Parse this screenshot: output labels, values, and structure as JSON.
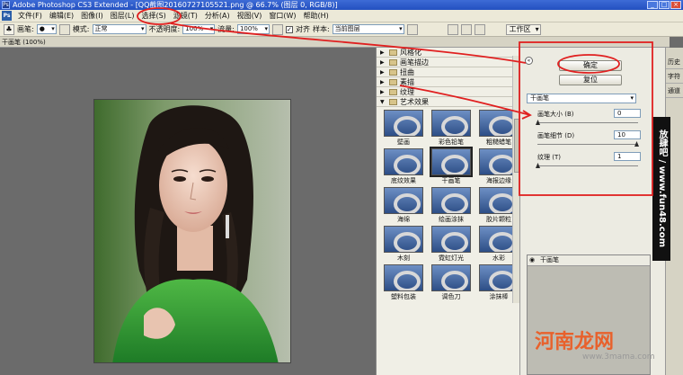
{
  "window": {
    "title": "Adobe Photoshop CS3 Extended - [QQ截图20160727105521.png @ 66.7% (图层 0, RGB/8)]",
    "controls": [
      "_",
      "□",
      "×"
    ]
  },
  "menubar": {
    "items": [
      "文件(F)",
      "编辑(E)",
      "图像(I)",
      "图层(L)",
      "选择(S)",
      "滤镜(T)",
      "分析(A)",
      "视图(V)",
      "窗口(W)",
      "帮助(H)"
    ]
  },
  "options_bar": {
    "tool_label": "画笔:",
    "mode_label": "模式:",
    "mode_value": "正常",
    "opacity_label": "不透明度:",
    "opacity_value": "100%",
    "flow_label": "流量:",
    "flow_value": "100%",
    "align_label": "对齐",
    "sample_label": "样本:",
    "sample_value": "当前图层",
    "workspace_label": "工作区"
  },
  "document": {
    "tab_label": "干画笔 (100%)"
  },
  "gallery": {
    "categories": [
      "风格化",
      "画笔描边",
      "扭曲",
      "素描",
      "纹理"
    ],
    "open_category": "艺术效果",
    "filters": [
      "壁画",
      "彩色铅笔",
      "粗糙蜡笔",
      "底纹效果",
      "干画笔",
      "海报边缘",
      "海绵",
      "绘画涂抹",
      "胶片颗粒",
      "木刻",
      "霓虹灯光",
      "水彩",
      "塑料包装",
      "调色刀",
      "涂抹棒"
    ],
    "selected_filter": "干画笔"
  },
  "options_panel": {
    "ok_label": "确定",
    "reset_label": "复位",
    "filter_select_value": "干画笔",
    "params": [
      {
        "label": "画笔大小 (B)",
        "value": "0",
        "level": 0.0
      },
      {
        "label": "画笔细节 (D)",
        "value": "10",
        "level": 1.0
      },
      {
        "label": "纹理 (T)",
        "value": "1",
        "level": 0.0
      }
    ],
    "layers": [
      {
        "label": "干画笔"
      }
    ]
  },
  "palette_tabs": [
    "历史",
    "字符",
    "通道"
  ],
  "watermarks": {
    "vertical": "放肆吧 / www.fun48.com",
    "brand": "河南龙网",
    "site": "www.3mama.com"
  },
  "colors": {
    "title_bar": "#2350c0",
    "annotation_red": "#e02020",
    "brand_orange": "#e8612c"
  }
}
